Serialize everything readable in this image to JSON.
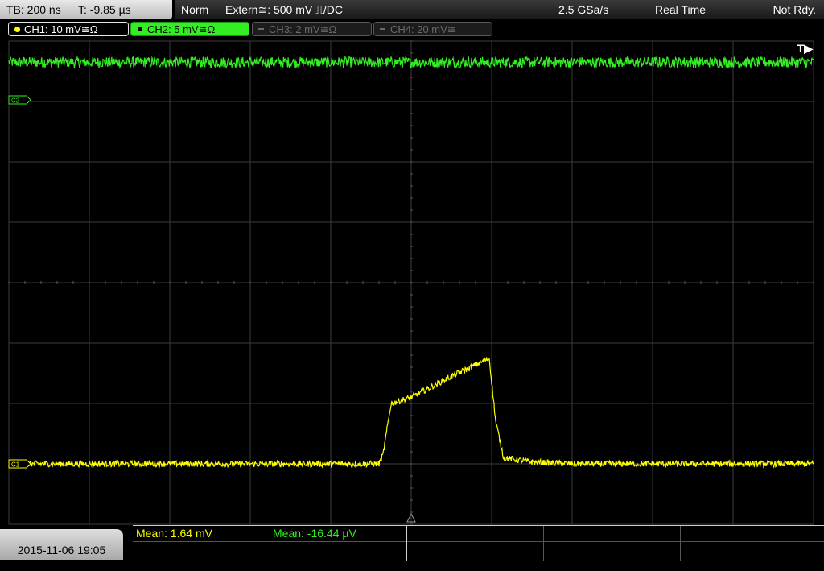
{
  "topbar": {
    "timebase": "TB: 200 ns",
    "trigger_time": "T: -9.85 µs",
    "trigger_mode": "Norm",
    "trigger_source": "Extern≅: 500 mV ⎍/DC",
    "sample_rate": "2.5 GSa/s",
    "acq_mode": "Real Time",
    "status": "Not Rdy."
  },
  "channels": [
    {
      "label": "CH1: 10 mV≅Ω",
      "color": "#ffff00",
      "state": "active"
    },
    {
      "label": "CH2: 5 mV≅Ω",
      "color": "#33ee22",
      "state": "selected"
    },
    {
      "label": "CH3: 2 mV≅Ω",
      "color": "#6a6a6a",
      "state": "off"
    },
    {
      "label": "CH4: 20 mV≅",
      "color": "#6a6a6a",
      "state": "off"
    }
  ],
  "trigger_marker": "T▶",
  "ref_markers": {
    "ch1": "C1",
    "ch2": "C2"
  },
  "measurements": {
    "ch1_mean": "Mean: 1.64 mV",
    "ch2_mean": "Mean: -16.44 µV"
  },
  "datetime": "2015-11-06 19:05",
  "colors": {
    "ch1": "#ffff00",
    "ch2": "#33ee22",
    "grid": "#3c3c3c"
  },
  "chart_data": {
    "type": "line",
    "x_divisions": 10,
    "y_divisions": 8,
    "series": [
      {
        "name": "CH2",
        "x_div": [
          0,
          10
        ],
        "y_div": [
          3.65,
          3.65
        ]
      },
      {
        "name": "CH1",
        "x_div": [
          0,
          4.6,
          4.65,
          4.75,
          5.0,
          5.5,
          5.9,
          5.97,
          6.05,
          6.15,
          6.5,
          7.0,
          10
        ],
        "y_div": [
          -3.0,
          -3.0,
          -2.85,
          -2.0,
          -1.9,
          -1.55,
          -1.3,
          -1.25,
          -2.3,
          -2.9,
          -2.97,
          -3.0,
          -3.0
        ]
      }
    ]
  }
}
